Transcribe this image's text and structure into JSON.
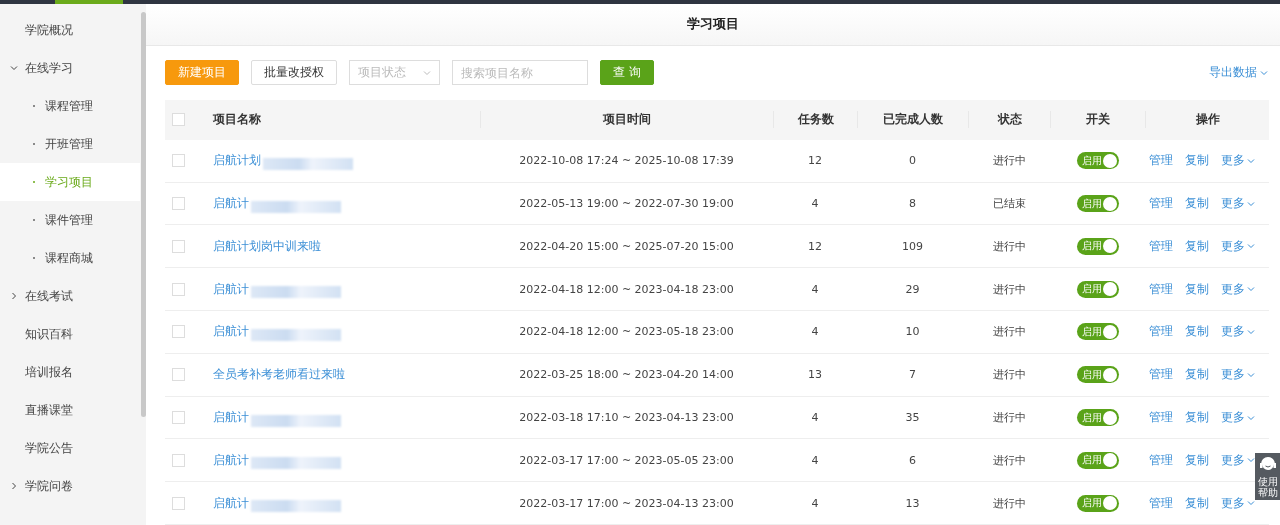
{
  "sidebar": {
    "items": [
      {
        "label": "学院概况",
        "selected": false
      },
      {
        "label": "在线学习",
        "expanded": true,
        "selected": false,
        "children": [
          {
            "label": "课程管理",
            "selected": false
          },
          {
            "label": "开班管理",
            "selected": false
          },
          {
            "label": "学习项目",
            "selected": true
          },
          {
            "label": "课件管理",
            "selected": false
          },
          {
            "label": "课程商城",
            "selected": false
          }
        ]
      },
      {
        "label": "在线考试",
        "expanded": false,
        "selected": false
      },
      {
        "label": "知识百科",
        "selected": false
      },
      {
        "label": "培训报名",
        "selected": false
      },
      {
        "label": "直播课堂",
        "selected": false
      },
      {
        "label": "学院公告",
        "selected": false
      },
      {
        "label": "学院问卷",
        "expanded": false,
        "selected": false
      }
    ]
  },
  "page_title": "学习项目",
  "toolbar": {
    "new_button": "新建项目",
    "batch_button": "批量改授权",
    "status_select": {
      "placeholder": "项目状态"
    },
    "search": {
      "placeholder": "搜索项目名称"
    },
    "query_button": "查 询",
    "export": "导出数据"
  },
  "table": {
    "select_all_checked": false,
    "columns": [
      "项目名称",
      "项目时间",
      "任务数",
      "已完成人数",
      "状态",
      "开关",
      "操作"
    ],
    "rows": [
      {
        "name": "启航计划",
        "redacted": true,
        "time": "2022-10-08 17:24 ~ 2025-10-08 17:39",
        "tasks": "12",
        "done": "0",
        "status": "进行中",
        "switch": {
          "label": "启用",
          "on": true
        },
        "actions": [
          "管理",
          "复制",
          "更多"
        ],
        "checked": false
      },
      {
        "name": "启航计",
        "redacted": true,
        "time": "2022-05-13 19:00 ~ 2022-07-30 19:00",
        "tasks": "4",
        "done": "8",
        "status": "已结束",
        "switch": {
          "label": "启用",
          "on": true
        },
        "actions": [
          "管理",
          "复制",
          "更多"
        ],
        "checked": false
      },
      {
        "name": "启航计划岗中训来啦",
        "redacted": false,
        "time": "2022-04-20 15:00 ~ 2025-07-20 15:00",
        "tasks": "12",
        "done": "109",
        "status": "进行中",
        "switch": {
          "label": "启用",
          "on": true
        },
        "actions": [
          "管理",
          "复制",
          "更多"
        ],
        "checked": false
      },
      {
        "name": "启航计",
        "redacted": true,
        "time": "2022-04-18 12:00 ~ 2023-04-18 23:00",
        "tasks": "4",
        "done": "29",
        "status": "进行中",
        "switch": {
          "label": "启用",
          "on": true
        },
        "actions": [
          "管理",
          "复制",
          "更多"
        ],
        "checked": false
      },
      {
        "name": "启航计",
        "redacted": true,
        "time": "2022-04-18 12:00 ~ 2023-05-18 23:00",
        "tasks": "4",
        "done": "10",
        "status": "进行中",
        "switch": {
          "label": "启用",
          "on": true
        },
        "actions": [
          "管理",
          "复制",
          "更多"
        ],
        "checked": false
      },
      {
        "name": "全员考补考老师看过来啦",
        "redacted": false,
        "time": "2022-03-25 18:00 ~ 2023-04-20 14:00",
        "tasks": "13",
        "done": "7",
        "status": "进行中",
        "switch": {
          "label": "启用",
          "on": true
        },
        "actions": [
          "管理",
          "复制",
          "更多"
        ],
        "checked": false
      },
      {
        "name": "启航计",
        "redacted": true,
        "time": "2022-03-18 17:10 ~ 2023-04-13 23:00",
        "tasks": "4",
        "done": "35",
        "status": "进行中",
        "switch": {
          "label": "启用",
          "on": true
        },
        "actions": [
          "管理",
          "复制",
          "更多"
        ],
        "checked": false
      },
      {
        "name": "启航计",
        "redacted": true,
        "time": "2022-03-17 17:00 ~ 2023-05-05 23:00",
        "tasks": "4",
        "done": "6",
        "status": "进行中",
        "switch": {
          "label": "启用",
          "on": true
        },
        "actions": [
          "管理",
          "复制",
          "更多"
        ],
        "checked": false
      },
      {
        "name": "启航计",
        "redacted": true,
        "time": "2022-03-17 17:00 ~ 2023-04-13 23:00",
        "tasks": "4",
        "done": "13",
        "status": "进行中",
        "switch": {
          "label": "启用",
          "on": true
        },
        "actions": [
          "管理",
          "复制",
          "更多"
        ],
        "checked": false
      }
    ]
  },
  "help_widget": {
    "label": "使用帮助"
  }
}
